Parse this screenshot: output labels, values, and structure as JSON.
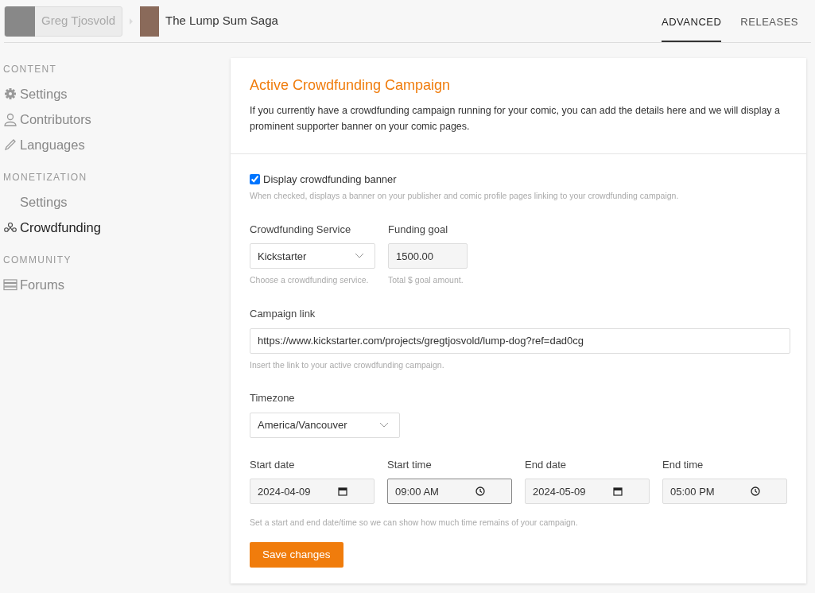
{
  "breadcrumb": {
    "publisher": "Greg Tjosvold",
    "comic": "The Lump Sum Saga"
  },
  "tabs": [
    {
      "label": "ADVANCED",
      "selected": true
    },
    {
      "label": "RELEASES",
      "selected": false
    }
  ],
  "sidebar": {
    "sections": [
      {
        "heading": "CONTENT",
        "items": [
          {
            "label": "Settings",
            "kind": "gear",
            "selected": false
          },
          {
            "label": "Contributors",
            "kind": "person",
            "selected": false
          },
          {
            "label": "Languages",
            "kind": "pencil",
            "selected": false
          }
        ]
      },
      {
        "heading": "MONETIZATION",
        "items": [
          {
            "label": "Settings",
            "kind": "plain",
            "selected": false
          },
          {
            "label": "Crowdfunding",
            "kind": "people",
            "selected": true
          }
        ]
      },
      {
        "heading": "COMMUNITY",
        "items": [
          {
            "label": "Forums",
            "kind": "list",
            "selected": false
          }
        ]
      }
    ]
  },
  "panel": {
    "title": "Active Crowdfunding Campaign",
    "intro": "If you currently have a crowdfunding campaign running for your comic, you can add the details here and we will display a prominent supporter banner on your comic pages.",
    "banner_checkbox": {
      "label": "Display crowdfunding banner",
      "checked": true,
      "help": "When checked, displays a banner on your publisher and comic profile pages linking to your crowdfunding campaign."
    },
    "service": {
      "label": "Crowdfunding Service",
      "value": "Kickstarter",
      "help": "Choose a crowdfunding service."
    },
    "goal": {
      "label": "Funding goal",
      "value": "1500.00",
      "help": "Total $ goal amount."
    },
    "link": {
      "label": "Campaign link",
      "value": "https://www.kickstarter.com/projects/gregtjosvold/lump-dog?ref=dad0cg",
      "help": "Insert the link to your active crowdfunding campaign."
    },
    "timezone": {
      "label": "Timezone",
      "value": "America/Vancouver"
    },
    "datetimes": [
      {
        "label": "Start date",
        "value": "2024-04-09",
        "kind": "date",
        "focused": false
      },
      {
        "label": "Start time",
        "value": "09:00 AM",
        "kind": "time",
        "focused": true
      },
      {
        "label": "End date",
        "value": "2024-05-09",
        "kind": "date",
        "focused": false
      },
      {
        "label": "End time",
        "value": "05:00 PM",
        "kind": "time",
        "focused": false
      }
    ],
    "datetime_help": "Set a start and end date/time so we can show how much time remains of your campaign.",
    "save_button": "Save changes"
  }
}
